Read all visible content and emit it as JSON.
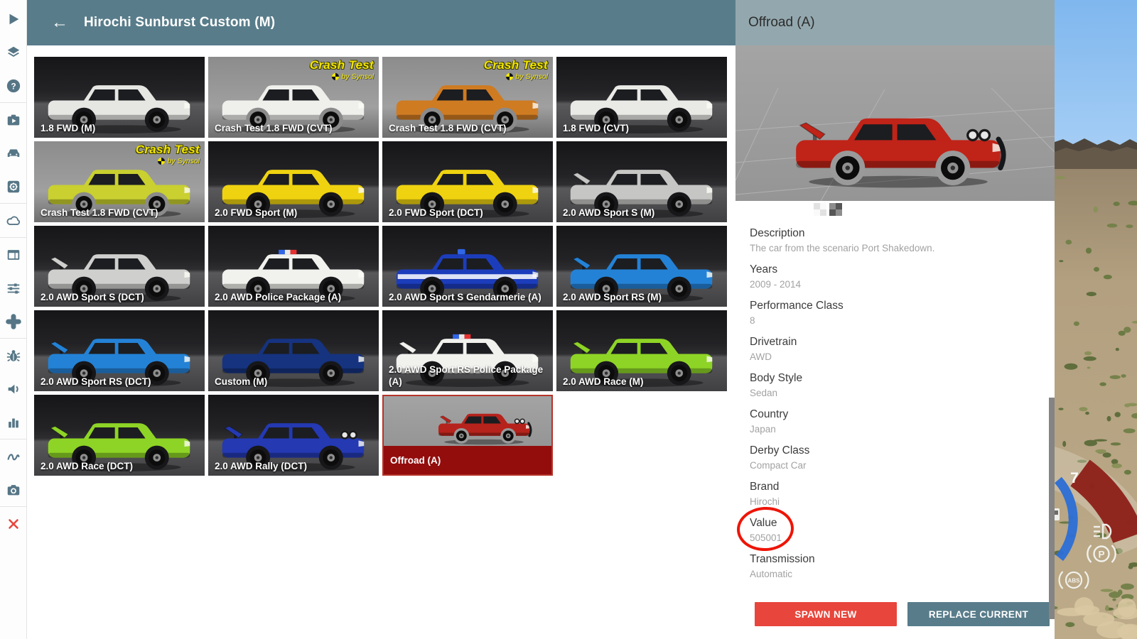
{
  "header": {
    "back_icon": "←",
    "title": "Hirochi Sunburst Custom (M)"
  },
  "sidebar": {
    "items": [
      {
        "icon": "play-icon"
      },
      {
        "icon": "layers-icon"
      },
      {
        "icon": "help-icon",
        "divider_after": true
      },
      {
        "icon": "scenarios-briefcase-icon"
      },
      {
        "icon": "vehicles-car-icon"
      },
      {
        "icon": "settings-gear-icon",
        "divider_after": true
      },
      {
        "icon": "cloud-icon",
        "divider_after": true
      },
      {
        "icon": "interface-layout-icon"
      },
      {
        "icon": "tuning-sliders-icon"
      },
      {
        "icon": "controller-icon",
        "divider_after": true
      },
      {
        "icon": "bug-icon"
      },
      {
        "icon": "audio-speaker-icon"
      },
      {
        "icon": "stats-bars-icon",
        "divider_after": true
      },
      {
        "icon": "path-squiggle-icon"
      },
      {
        "icon": "camera-icon",
        "divider_after": true
      },
      {
        "icon": "close-x-icon"
      }
    ]
  },
  "crash_logo": {
    "line1": "Crash Test",
    "line2": "by Synsol"
  },
  "grid": {
    "vehicles": [
      {
        "label": "1.8 FWD (M)",
        "color": "#e6e6e3",
        "bg": "dark"
      },
      {
        "label": "Crash Test 1.8 FWD (CVT)",
        "color": "#efefec",
        "bg": "light",
        "crash_logo": true
      },
      {
        "label": "Crash Test 1.8 FWD (CVT)",
        "color": "#cf7b22",
        "bg": "light",
        "crash_logo": true
      },
      {
        "label": "1.8 FWD (CVT)",
        "color": "#e9e9e6",
        "bg": "dark"
      },
      {
        "label": "Crash Test 1.8 FWD (CVT)",
        "color": "#c9d02f",
        "bg": "light",
        "crash_logo": true
      },
      {
        "label": "2.0 FWD Sport (M)",
        "color": "#efd310",
        "bg": "dark"
      },
      {
        "label": "2.0 FWD Sport (DCT)",
        "color": "#efd310",
        "bg": "dark"
      },
      {
        "label": "2.0 AWD Sport S (M)",
        "color": "#c6c6c4",
        "bg": "dark",
        "spoiler": true
      },
      {
        "label": "2.0 AWD Sport S (DCT)",
        "color": "#cfcfcd",
        "bg": "dark",
        "spoiler": true
      },
      {
        "label": "2.0 AWD Police Package (A)",
        "color": "#f1f1ee",
        "bg": "dark",
        "lightbar": "police"
      },
      {
        "label": "2.0 AWD Sport S Gendarmerie (A)",
        "color": "#1c3dbb",
        "bg": "dark",
        "lightbar": "blue",
        "stripe": true
      },
      {
        "label": "2.0 AWD Sport RS (M)",
        "color": "#2482d6",
        "bg": "dark",
        "spoiler": true
      },
      {
        "label": "2.0 AWD Sport RS (DCT)",
        "color": "#2482d6",
        "bg": "dark",
        "spoiler": true
      },
      {
        "label": "Custom (M)",
        "color": "#15337f",
        "bg": "dark"
      },
      {
        "label": "2.0 AWD Sport RS Police Package (A)",
        "color": "#f1f1ee",
        "bg": "dark",
        "lightbar": "police",
        "spoiler": true
      },
      {
        "label": "2.0 AWD Race (M)",
        "color": "#8ed426",
        "bg": "dark",
        "spoiler": true
      },
      {
        "label": "2.0 AWD Race (DCT)",
        "color": "#8ed426",
        "bg": "dark",
        "spoiler": true
      },
      {
        "label": "2.0 AWD Rally (DCT)",
        "color": "#2439b2",
        "bg": "dark",
        "spoiler": true,
        "lights": true
      },
      {
        "label": "Offroad (A)",
        "color": "#b5231c",
        "bg": "sel",
        "selected": true,
        "spoiler": true,
        "lights": true,
        "bullbar": true
      }
    ]
  },
  "details": {
    "title": "Offroad (A)",
    "preview_vehicle": {
      "color": "#c02318",
      "spoiler": true,
      "lights": true,
      "bullbar": true
    },
    "swatches": [
      "white-checker",
      "gray-checker"
    ],
    "specs": [
      {
        "label": "Description",
        "value": "The car from the scenario Port Shakedown."
      },
      {
        "label": "Years",
        "value": "2009 - 2014"
      },
      {
        "label": "Performance Class",
        "value": "8"
      },
      {
        "label": "Drivetrain",
        "value": "AWD"
      },
      {
        "label": "Body Style",
        "value": "Sedan"
      },
      {
        "label": "Country",
        "value": "Japan"
      },
      {
        "label": "Derby Class",
        "value": "Compact Car"
      },
      {
        "label": "Brand",
        "value": "Hirochi"
      },
      {
        "label": "Value",
        "value": "505001",
        "annotated": true
      },
      {
        "label": "Transmission",
        "value": "Automatic"
      }
    ],
    "annotation_color": "#ee1507",
    "buttons": {
      "spawn": "SPAWN NEW",
      "replace": "REPLACE CURRENT"
    }
  },
  "hud": {
    "tach_number": "7",
    "indicators": [
      "fuel-icon",
      "headlight-icon",
      "parking-brake-icon",
      "abs-icon"
    ],
    "parking_letter": "P",
    "abs_label": "ABS",
    "redline_color": "#8f221b",
    "speed_arc_color": "#2e6fd6"
  },
  "colors": {
    "header_bg": "#587c8a",
    "panel_header_bg": "#93a8ae",
    "accent_red": "#e8463c",
    "selected_band": "#930d0d",
    "selected_border": "#b5342a",
    "sidebar_icon": "#567686",
    "sky": "#8cc0f2",
    "desert": "#b3a080"
  }
}
